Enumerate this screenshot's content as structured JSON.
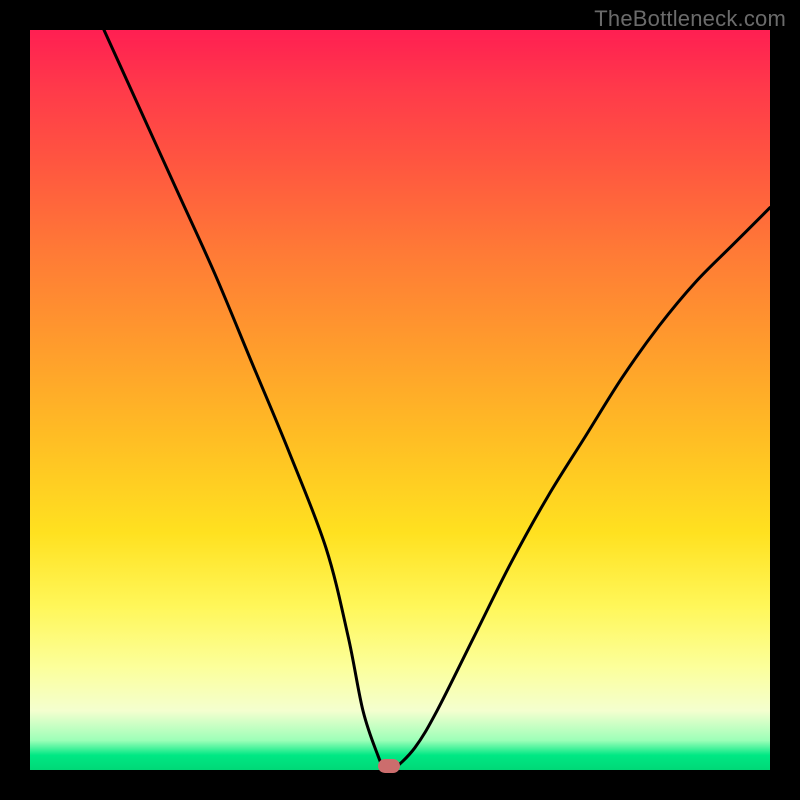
{
  "watermark": "TheBottleneck.com",
  "chart_data": {
    "type": "line",
    "title": "",
    "xlabel": "",
    "ylabel": "",
    "xlim": [
      0,
      100
    ],
    "ylim": [
      0,
      100
    ],
    "grid": false,
    "series": [
      {
        "name": "curve",
        "x": [
          10,
          15,
          20,
          25,
          30,
          35,
          40,
          43,
          45,
          47,
          48,
          49,
          52,
          55,
          60,
          65,
          70,
          75,
          80,
          85,
          90,
          95,
          100
        ],
        "values": [
          100,
          89,
          78,
          67,
          55,
          43,
          30,
          18,
          8,
          2,
          0,
          0,
          3,
          8,
          18,
          28,
          37,
          45,
          53,
          60,
          66,
          71,
          76
        ]
      }
    ],
    "marker": {
      "x": 48.5,
      "y": 0.6,
      "color": "#cc6d6d"
    },
    "gradient_stops": [
      {
        "pos": 0,
        "color": "#ff1f52"
      },
      {
        "pos": 8,
        "color": "#ff3a4a"
      },
      {
        "pos": 18,
        "color": "#ff5640"
      },
      {
        "pos": 30,
        "color": "#ff7a36"
      },
      {
        "pos": 42,
        "color": "#ff9a2d"
      },
      {
        "pos": 55,
        "color": "#ffbd24"
      },
      {
        "pos": 68,
        "color": "#ffe120"
      },
      {
        "pos": 78,
        "color": "#fff75a"
      },
      {
        "pos": 86,
        "color": "#fcff9a"
      },
      {
        "pos": 92,
        "color": "#f4ffcf"
      },
      {
        "pos": 96,
        "color": "#9cffb8"
      },
      {
        "pos": 98,
        "color": "#00e884"
      },
      {
        "pos": 100,
        "color": "#00d877"
      }
    ]
  }
}
